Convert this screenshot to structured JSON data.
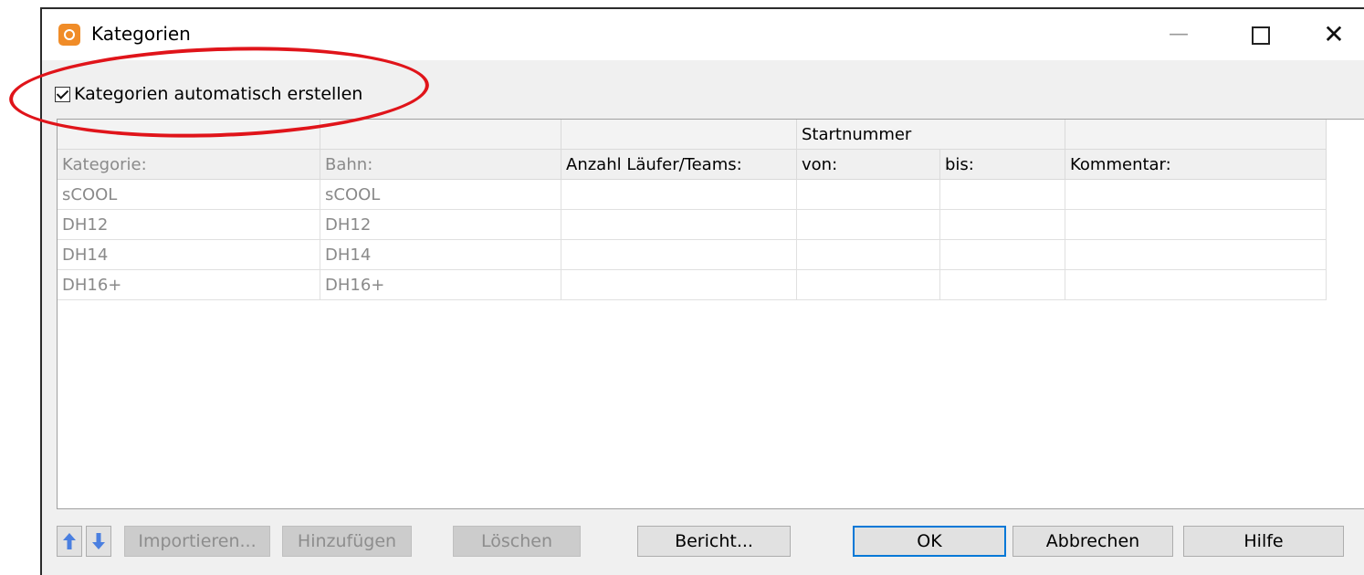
{
  "window": {
    "title": "Kategorien",
    "minimize_glyph": "—",
    "close_glyph": "✕"
  },
  "auto_create": {
    "label": "Kategorien automatisch erstellen",
    "checked": true
  },
  "table": {
    "group_header": "Startnummer",
    "columns": [
      "Kategorie:",
      "Bahn:",
      "Anzahl Läufer/Teams:",
      "von:",
      "bis:",
      "Kommentar:"
    ],
    "rows": [
      {
        "kategorie": "sCOOL",
        "bahn": "sCOOL",
        "anzahl": "",
        "von": "",
        "bis": "",
        "kommentar": ""
      },
      {
        "kategorie": "DH12",
        "bahn": "DH12",
        "anzahl": "",
        "von": "",
        "bis": "",
        "kommentar": ""
      },
      {
        "kategorie": "DH14",
        "bahn": "DH14",
        "anzahl": "",
        "von": "",
        "bis": "",
        "kommentar": ""
      },
      {
        "kategorie": "DH16+",
        "bahn": "DH16+",
        "anzahl": "",
        "von": "",
        "bis": "",
        "kommentar": ""
      }
    ]
  },
  "buttons": {
    "importieren": "Importieren...",
    "hinzufuegen": "Hinzufügen",
    "loeschen": "Löschen",
    "bericht": "Bericht...",
    "ok": "OK",
    "abbrechen": "Abbrechen",
    "hilfe": "Hilfe"
  },
  "colors": {
    "accent": "#0078d7",
    "highlight_ellipse": "#e0141a",
    "app_icon": "#f08c28",
    "arrow": "#4a7fe0"
  }
}
